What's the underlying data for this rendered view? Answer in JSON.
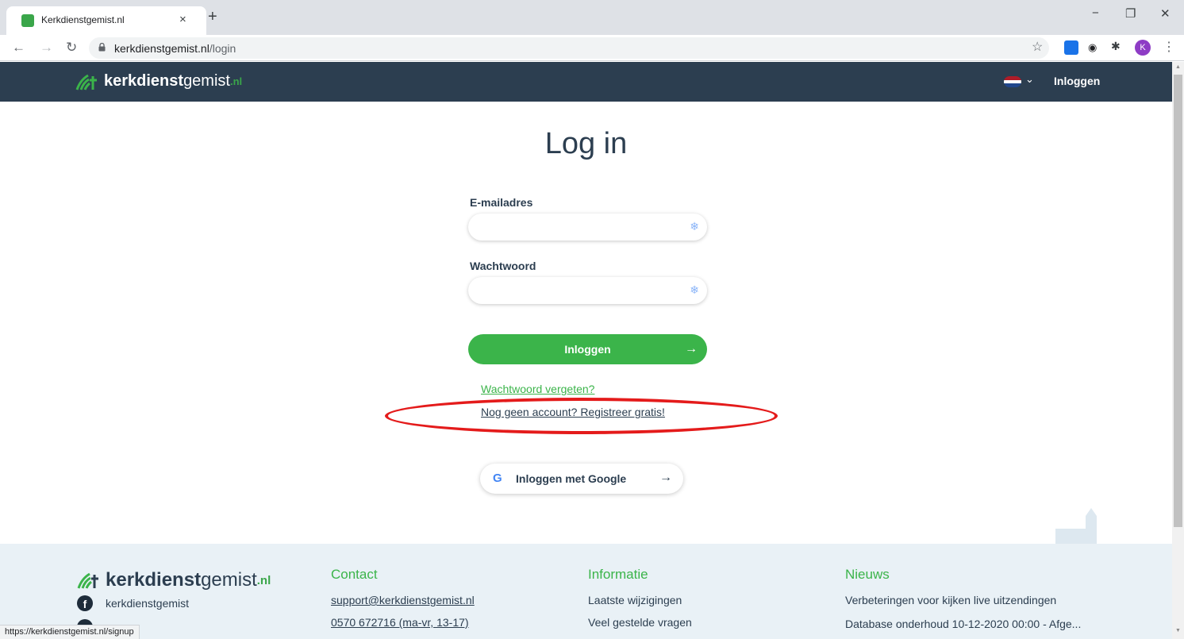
{
  "browser": {
    "tab_title": "Kerkdienstgemist.nl",
    "tab_close": "×",
    "new_tab": "+",
    "url_host": "kerkdienstgemist.nl",
    "url_path": "/login",
    "profile_initial": "K",
    "status_url": "https://kerkdienstgemist.nl/signup"
  },
  "header": {
    "logo_bold": "kerkdienst",
    "logo_light": "gemist",
    "logo_tld": ".nl",
    "login_label": "Inloggen"
  },
  "form": {
    "title": "Log in",
    "email_label": "E-mailadres",
    "email_value": "",
    "password_label": "Wachtwoord",
    "password_value": "",
    "submit_label": "Inloggen",
    "arrow": "→",
    "forgot_link": "Wachtwoord vergeten?",
    "register_link": "Nog geen account? Registreer gratis!",
    "google_label": "Inloggen met Google",
    "google_glyph": "G"
  },
  "footer": {
    "social": {
      "facebook": "kerkdienstgemist"
    },
    "contact": {
      "heading": "Contact",
      "email": "support@kerkdienstgemist.nl",
      "phone": "0570 672716 (ma-vr, 13-17)"
    },
    "info": {
      "heading": "Informatie",
      "items": [
        "Laatste wijzigingen",
        "Veel gestelde vragen"
      ]
    },
    "news": {
      "heading": "Nieuws",
      "items": [
        "Verbeteringen voor kijken live uitzendingen",
        "Database onderhoud 10-12-2020 00:00 - Afge..."
      ]
    }
  },
  "colors": {
    "brand_green": "#3bb44a",
    "header_navy": "#2c3e50",
    "annotation_red": "#e41b1b"
  }
}
